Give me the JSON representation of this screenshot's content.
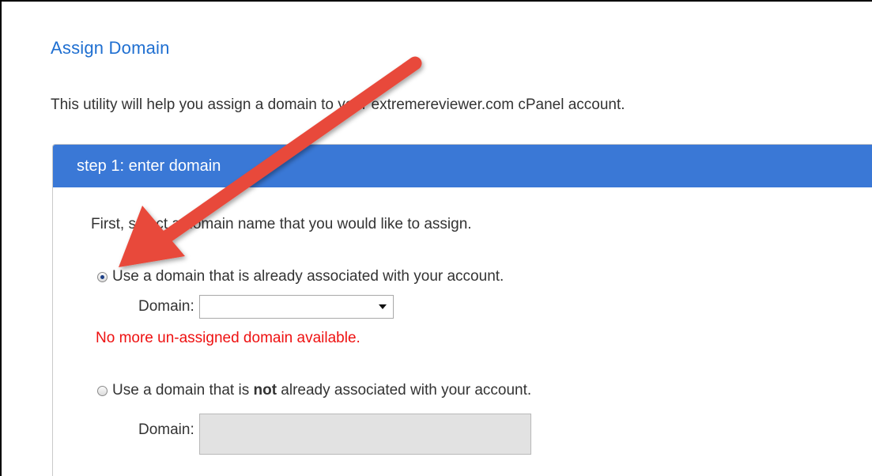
{
  "page": {
    "title": "Assign Domain",
    "intro": "This utility will help you assign a domain to your extremereviewer.com cPanel account."
  },
  "step1": {
    "header": "step 1: enter domain",
    "lead": "First, select a domain name that you would like to assign.",
    "option_existing": {
      "label": "Use a domain that is already associated with your account.",
      "selected": true,
      "domain_label": "Domain:",
      "domain_value": "",
      "error": "No more un-assigned domain available."
    },
    "option_new": {
      "label_before": "Use a domain that is ",
      "label_bold": "not",
      "label_after": " already associated with your account.",
      "selected": false,
      "domain_label": "Domain:",
      "domain_value": ""
    }
  },
  "colors": {
    "title": "#1f6fd1",
    "header_bg": "#3a78d6",
    "error": "#ee1111",
    "annotation_arrow": "#e8493a"
  },
  "icons": {
    "dropdown": "caret-down-icon",
    "annotation": "red-arrow-annotation"
  }
}
